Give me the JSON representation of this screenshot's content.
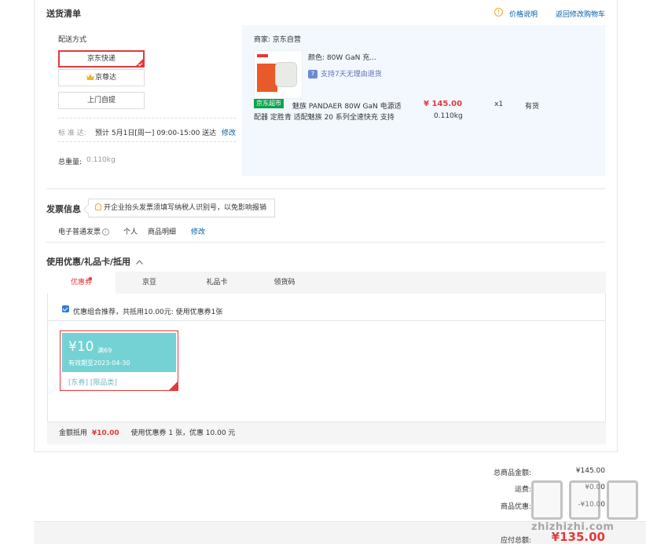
{
  "delivery": {
    "title": "送货清单",
    "price_note": "价格说明",
    "back_to_cart": "返回修改购物车",
    "shipping_method_label": "配送方式",
    "options": [
      "京东快递",
      "京尊达",
      "上门自提"
    ],
    "standard_label": "标 准 达:",
    "standard_text": "预计 5月1日[周一] 09:00-15:00 送达",
    "modify": "修改",
    "weight_label": "总重量:",
    "weight_value": "0.110kg"
  },
  "product": {
    "seller": "商家: 京东自营",
    "color": "颜色: 80W GaN 充...",
    "return_policy": "支持7天无理由退货",
    "return_badge": "7",
    "supermarket_tag": "京东超市",
    "name_line1": "魅族 PANDAER 80W GaN 电源适",
    "name_line2": "配器 定胜青 适配魅族 20 系列全速快充 支持",
    "price": "¥ 145.00",
    "weight": "0.110kg",
    "qty": "x1",
    "stock": "有货"
  },
  "invoice": {
    "title": "发票信息",
    "tip": "开企业抬头发票须填写纳税人识别号，以免影响报销",
    "type": "电子普通发票",
    "info_icon": "i",
    "person": "个人",
    "detail": "商品明细",
    "modify": "修改"
  },
  "coupons": {
    "title": "使用优惠/礼品卡/抵用",
    "tabs": [
      "优惠券",
      "京豆",
      "礼品卡",
      "领货码"
    ],
    "recommend_text": "优惠组合推荐，共抵用10.00元: 使用优惠券1张",
    "coupon": {
      "amount": "¥10",
      "condition": "满69",
      "expiry": "有效期至2023-04-30",
      "tags": "[东券] [限品类]"
    },
    "footer_label": "金额抵用",
    "footer_amount": "¥10.00",
    "footer_text": "使用优惠券 1 张，优惠 10.00 元"
  },
  "totals": {
    "goods_label": "总商品金额:",
    "goods_value": "¥145.00",
    "freight_label": "运费:",
    "freight_value": "¥0.00",
    "discount_label": "商品优惠:",
    "discount_value": "-¥10.00",
    "payable_label": "应付总额:",
    "payable_value": "¥135.00"
  },
  "watermark": {
    "text": "zhizhizhi.com"
  }
}
